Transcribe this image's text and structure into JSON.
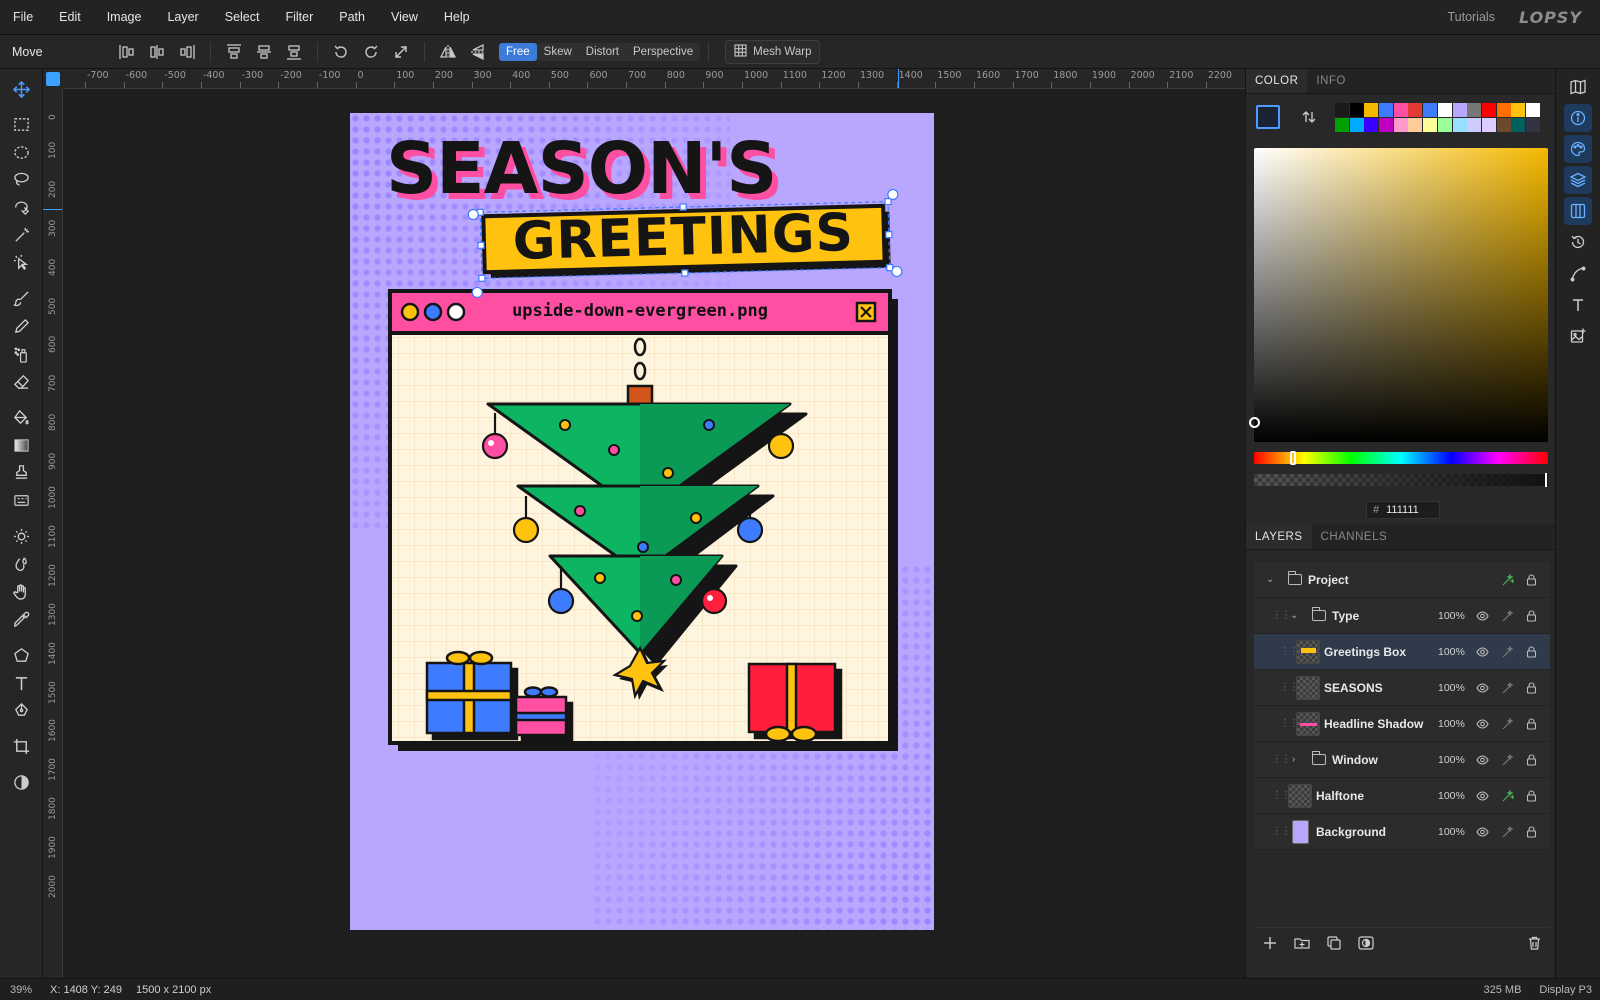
{
  "menubar": {
    "items": [
      "File",
      "Edit",
      "Image",
      "Layer",
      "Select",
      "Filter",
      "Path",
      "View",
      "Help"
    ],
    "tutorials": "Tutorials",
    "brand": "LOPSY"
  },
  "options": {
    "tool_name": "Move",
    "transform_modes": [
      "Free",
      "Skew",
      "Distort",
      "Perspective"
    ],
    "active_mode": "Free",
    "mesh_warp": "Mesh Warp"
  },
  "rulers": {
    "h_labels": [
      "-700",
      "-600",
      "-500",
      "-400",
      "-300",
      "-200",
      "-100",
      "0",
      "100",
      "200",
      "300",
      "400",
      "500",
      "600",
      "700",
      "800",
      "900",
      "1000",
      "1100",
      "1200",
      "1300",
      "1400",
      "1500",
      "1600",
      "1700",
      "1800",
      "1900",
      "2000",
      "2100",
      "2200"
    ],
    "v_labels": [
      "0",
      "100",
      "200",
      "300",
      "400",
      "500",
      "600",
      "700",
      "800",
      "900",
      "1000",
      "1100",
      "1200",
      "1300",
      "1400",
      "1500",
      "1600",
      "1700",
      "1800",
      "1900",
      "2000"
    ]
  },
  "artwork": {
    "headline": "SEASON'S",
    "subheadline": "GREETINGS",
    "window_title": "upside-down-evergreen.png",
    "colors": {
      "background": "#b9a7ff",
      "pink": "#ff4fa3",
      "yellow": "#ffc20e",
      "green": "#0aa85a",
      "blue": "#3d7bff",
      "cream": "#fff4dd"
    }
  },
  "color_panel": {
    "tabs": [
      "COLOR",
      "INFO"
    ],
    "active_tab": "COLOR",
    "hex_value": "111111",
    "hash": "#",
    "palette": [
      "#1a1a1a",
      "#000000",
      "#f5b900",
      "#3d7bff",
      "#ff4fa3",
      "#e53935",
      "#3d7bff",
      "#ffffff",
      "#b9a7ff",
      "#777777",
      "#ff0000",
      "#ff6f00",
      "#ffc20e",
      "#ffffff",
      "#00a000",
      "#00aaff",
      "#3a00ff",
      "#c000c0",
      "#ff99cc",
      "#ffcc99",
      "#ffff99",
      "#99ff99",
      "#99ddff",
      "#ccccff",
      "#ddccff",
      "#6b4a2b",
      "#006060",
      "#333344"
    ]
  },
  "layers_panel": {
    "tabs": [
      "LAYERS",
      "CHANNELS"
    ],
    "active_tab": "LAYERS",
    "layers": [
      {
        "name": "Project",
        "opacity": ""
      },
      {
        "name": "Type",
        "opacity": "100%"
      },
      {
        "name": "Greetings Box",
        "opacity": "100%"
      },
      {
        "name": "SEASONS",
        "opacity": "100%"
      },
      {
        "name": "Headline Shadow",
        "opacity": "100%"
      },
      {
        "name": "Window",
        "opacity": "100%"
      },
      {
        "name": "Halftone",
        "opacity": "100%"
      },
      {
        "name": "Background",
        "opacity": "100%"
      }
    ]
  },
  "status": {
    "zoom": "39%",
    "coords": "X: 1408  Y: 249",
    "dims": "1500 x 2100 px",
    "memory": "325 MB",
    "profile": "Display P3"
  }
}
